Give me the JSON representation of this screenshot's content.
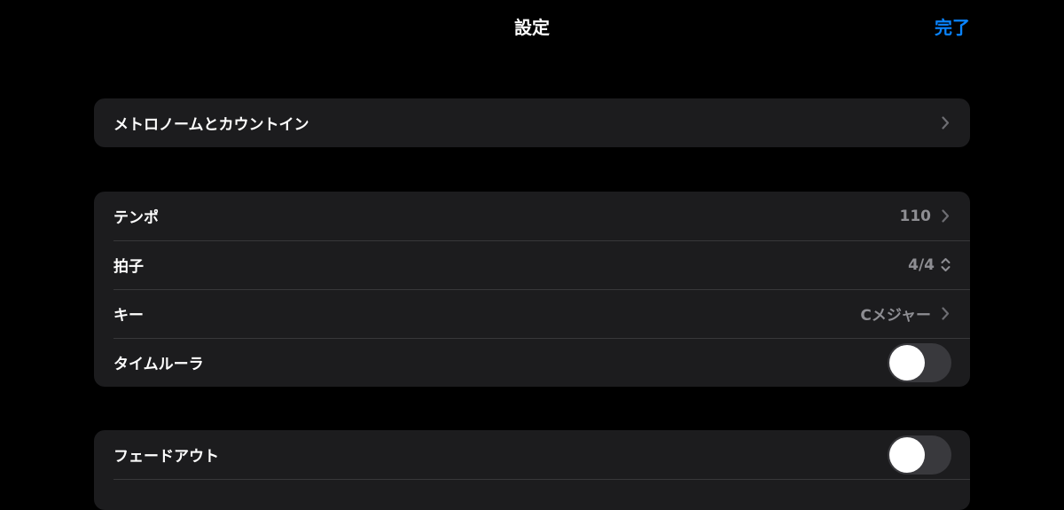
{
  "nav": {
    "title": "設定",
    "done_label": "完了"
  },
  "group1": {
    "items": [
      {
        "label": "メトロノームとカウントイン"
      }
    ]
  },
  "group2": {
    "items": [
      {
        "label": "テンポ",
        "value": "110"
      },
      {
        "label": "拍子",
        "value": "4/4"
      },
      {
        "label": "キー",
        "value": "Cメジャー"
      },
      {
        "label": "タイムルーラ",
        "toggle_on": false
      }
    ]
  },
  "group3": {
    "items": [
      {
        "label": "フェードアウト",
        "toggle_on": false
      }
    ]
  },
  "colors": {
    "background": "#000000",
    "group_background": "#1c1c1e",
    "accent": "#0a84ff",
    "secondary_text": "#8e8e93",
    "separator": "#38383a",
    "toggle_off": "#39393d"
  },
  "icons": {
    "disclosure": "chevron-right-icon",
    "stepper": "chevron-up-down-icon"
  }
}
